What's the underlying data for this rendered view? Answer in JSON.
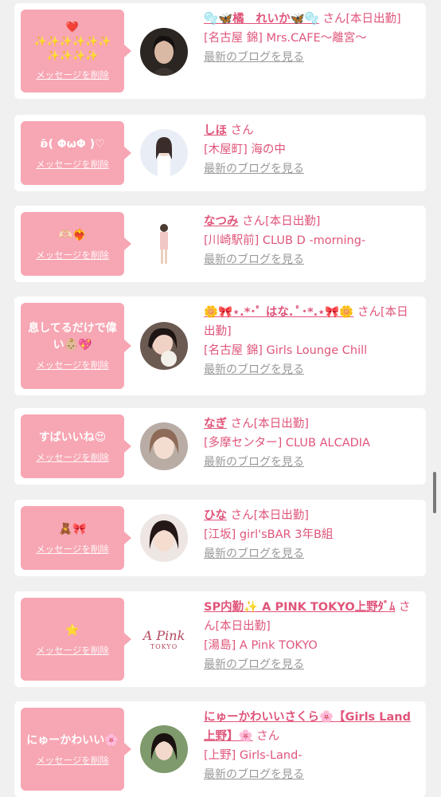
{
  "delete_label": "メッセージを削除",
  "blog_label": "最新のブログを見る",
  "san": "さん",
  "cards": [
    {
      "message": "❤️\n✨✨✨✨✨✨\n✨✨✨✨",
      "name": "🫧🦋橘　れいか🦋🫧",
      "suffix": "さん[本日出勤]",
      "shop": "[名古屋 錦] Mrs.CAFE〜離宮〜"
    },
    {
      "message": "ʚ̆( ΦωΦ )♡",
      "name": "しほ",
      "suffix": "さん",
      "shop": "[木屋町] 海の中"
    },
    {
      "message": "🫶🏻❤️‍🔥",
      "name": "なつみ",
      "suffix": "さん[本日出勤]",
      "shop": "[川崎駅前] CLUB D -morning-"
    },
    {
      "message": "息してるだけで偉い👶🏼💖",
      "name": "🌼🎀⋆.*･ﾟ はな. ﾟ･*.⋆🎀🌼",
      "suffix": "さん[本日出勤]",
      "shop": "[名古屋 錦] Girls Lounge Chill"
    },
    {
      "message": "すばいいね😍",
      "name": "なぎ",
      "suffix": "さん[本日出勤]",
      "shop": "[多摩センター] CLUB ALCADIA"
    },
    {
      "message": "🧸🎀",
      "name": "ひな",
      "suffix": "さん[本日出勤]",
      "shop": "[江坂] girl'sBAR 3年B組"
    },
    {
      "message": "⭐",
      "name": "SP内勤✨ A PINK TOKYO上野ﾀﾞﾑ",
      "suffix": "さん[本日出勤]",
      "shop": "[湯島] A Pink TOKYO",
      "logo_text": "A Pink",
      "logo_sub": "TOKYO"
    },
    {
      "message": "にゅーかわいい🌸",
      "name": "にゅーかわいいさくら🌸【Girls Land上野】🌸",
      "suffix": "さん",
      "shop": "[上野] Girls-Land-"
    }
  ]
}
